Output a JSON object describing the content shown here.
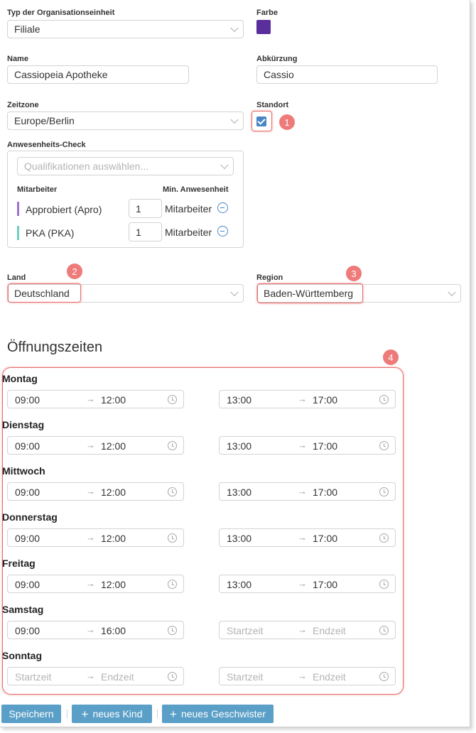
{
  "form": {
    "org_type": {
      "label": "Typ der Organisationseinheit",
      "value": "Filiale"
    },
    "color": {
      "label": "Farbe",
      "value": "#5a2f9c"
    },
    "name": {
      "label": "Name",
      "value": "Cassiopeia Apotheke"
    },
    "abbreviation": {
      "label": "Abkürzung",
      "value": "Cassio"
    },
    "timezone": {
      "label": "Zeitzone",
      "value": "Europe/Berlin"
    },
    "location": {
      "label": "Standort",
      "checked": true
    }
  },
  "presence_check": {
    "label": "Anwesenheits-Check",
    "placeholder": "Qualifikationen auswählen...",
    "col_employee": "Mitarbeiter",
    "col_min": "Min. Anwesenheit",
    "rows": [
      {
        "name": "Approbiert (Apro)",
        "count": "1",
        "unit": "Mitarbeiter",
        "color": "#9b72cf"
      },
      {
        "name": "PKA (PKA)",
        "count": "1",
        "unit": "Mitarbeiter",
        "color": "#6fd0be"
      }
    ]
  },
  "country": {
    "label": "Land",
    "value": "Deutschland"
  },
  "region": {
    "label": "Region",
    "value": "Baden-Württemberg"
  },
  "badges": [
    "1",
    "2",
    "3",
    "4"
  ],
  "opening_hours": {
    "title": "Öffnungszeiten",
    "arrow": "→",
    "days": [
      {
        "name": "Montag",
        "ranges": [
          {
            "start": "09:00",
            "end": "12:00",
            "empty": false
          },
          {
            "start": "13:00",
            "end": "17:00",
            "empty": false
          }
        ]
      },
      {
        "name": "Dienstag",
        "ranges": [
          {
            "start": "09:00",
            "end": "12:00",
            "empty": false
          },
          {
            "start": "13:00",
            "end": "17:00",
            "empty": false
          }
        ]
      },
      {
        "name": "Mittwoch",
        "ranges": [
          {
            "start": "09:00",
            "end": "12:00",
            "empty": false
          },
          {
            "start": "13:00",
            "end": "17:00",
            "empty": false
          }
        ]
      },
      {
        "name": "Donnerstag",
        "ranges": [
          {
            "start": "09:00",
            "end": "12:00",
            "empty": false
          },
          {
            "start": "13:00",
            "end": "17:00",
            "empty": false
          }
        ]
      },
      {
        "name": "Freitag",
        "ranges": [
          {
            "start": "09:00",
            "end": "12:00",
            "empty": false
          },
          {
            "start": "13:00",
            "end": "17:00",
            "empty": false
          }
        ]
      },
      {
        "name": "Samstag",
        "ranges": [
          {
            "start": "09:00",
            "end": "16:00",
            "empty": false
          },
          {
            "start": "Startzeit",
            "end": "Endzeit",
            "empty": true
          }
        ]
      },
      {
        "name": "Sonntag",
        "ranges": [
          {
            "start": "Startzeit",
            "end": "Endzeit",
            "empty": true
          },
          {
            "start": "Startzeit",
            "end": "Endzeit",
            "empty": true
          }
        ]
      }
    ]
  },
  "actions": {
    "save": "Speichern",
    "new_child": "neues Kind",
    "new_sibling": "neues Geschwister",
    "plus": "+"
  },
  "colors": {
    "accent": "#5a9fc7",
    "highlight": "#e96a6a",
    "checkbox": "#4a86c5"
  }
}
